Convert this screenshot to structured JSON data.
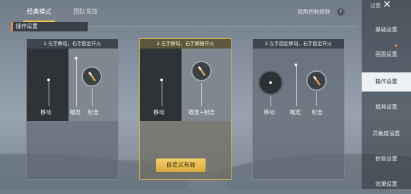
{
  "tabs": [
    {
      "label": "经典模式",
      "active": true
    },
    {
      "label": "团队竞技",
      "active": false
    }
  ],
  "view_control_rule": "视角控制规则",
  "help_glyph": "?",
  "section_title": "操作设置",
  "panels": [
    {
      "head": "1  左手移动，右手固定开火",
      "move": "移动",
      "aim": "瞄准",
      "fire": "射击",
      "selected": false
    },
    {
      "head": "2  左手移动，右手跟随开火",
      "move": "移动",
      "aim_fire": "瞄准+射击",
      "selected": true
    },
    {
      "head": "3  左手固定移动，右手固定开火",
      "move": "移动",
      "aim": "瞄准",
      "fire": "射击",
      "selected": false
    }
  ],
  "custom_layout_label": "自定义布局",
  "sidebar": {
    "title": "设置",
    "close_glyph": "✕",
    "items": [
      {
        "label": "基础设置",
        "active": false
      },
      {
        "label": "画面设置",
        "active": false,
        "has_badge": true
      },
      {
        "label": "操作设置",
        "active": true
      },
      {
        "label": "载具设置",
        "active": false
      },
      {
        "label": "灵敏度设置",
        "active": false
      },
      {
        "label": "拾取设置",
        "active": false
      },
      {
        "label": "效果设置",
        "active": false
      }
    ]
  },
  "colors": {
    "accent": "#f0c04a",
    "selected_border": "#d9b24c",
    "badge": "#e07a3a"
  }
}
